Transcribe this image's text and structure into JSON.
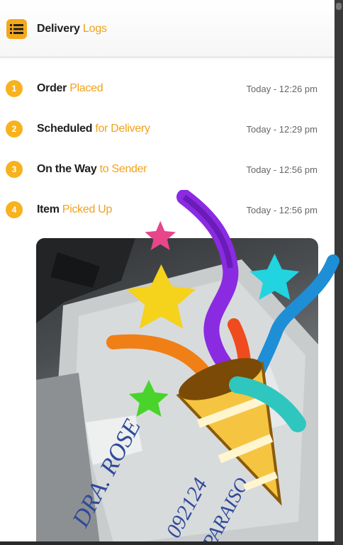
{
  "header": {
    "title_main": "Delivery",
    "title_accent": "Logs",
    "menu_icon": "menu-icon",
    "accent_color": "#f0a21c"
  },
  "logs": [
    {
      "number": "1",
      "main": "Order",
      "accent": "Placed",
      "time": "Today - 12:26 pm"
    },
    {
      "number": "2",
      "main": "Scheduled",
      "accent": "for Delivery",
      "time": "Today - 12:29 pm"
    },
    {
      "number": "3",
      "main": "On the Way",
      "accent": "to Sender",
      "time": "Today - 12:56 pm"
    },
    {
      "number": "4",
      "main": "Item",
      "accent": "Picked Up",
      "time": "Today - 12:56 pm"
    }
  ],
  "photo": {
    "handwriting": [
      "DRA. ROSE",
      "092124",
      "PARAISO"
    ],
    "sticker": "party-popper-icon"
  }
}
